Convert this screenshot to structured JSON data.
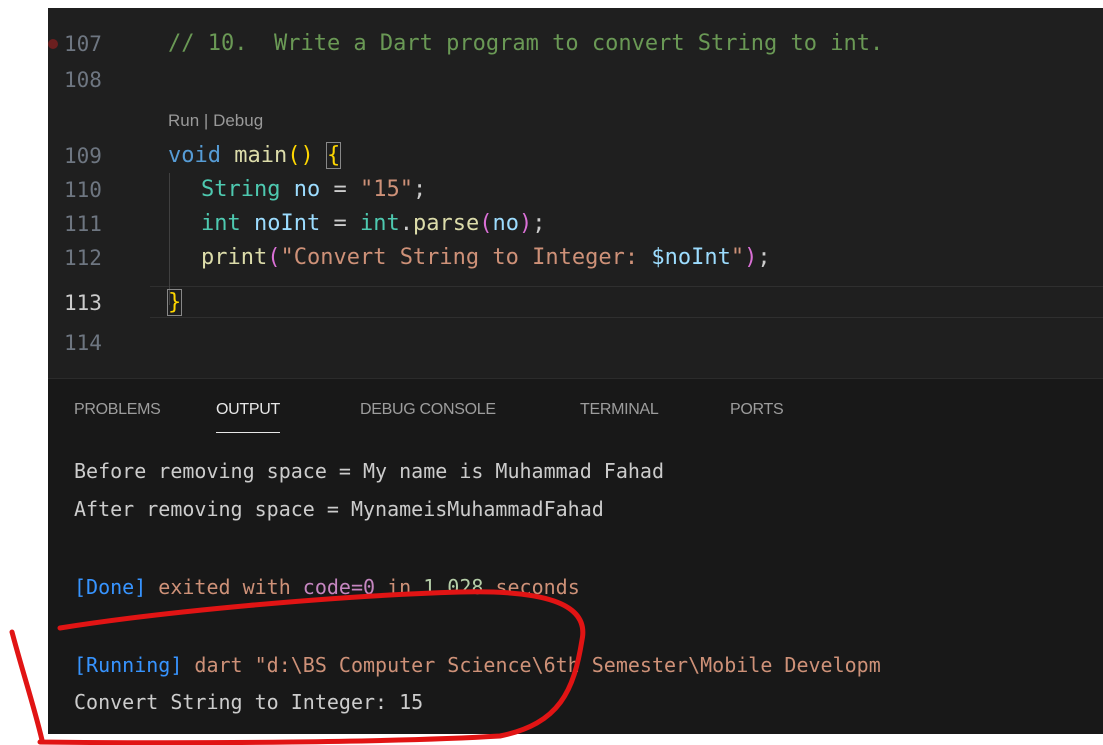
{
  "editor": {
    "line_numbers": [
      "107",
      "108",
      "109",
      "110",
      "111",
      "112",
      "113",
      "114"
    ],
    "comment": "// 10.  Write a Dart program to convert String to int.",
    "codelens": {
      "run": "Run",
      "separator": " | ",
      "debug": "Debug"
    },
    "code": {
      "void": "void",
      "main": "main",
      "parens": "()",
      "open_brace": "{",
      "string_type": "String",
      "no_var": "no",
      "eq": " = ",
      "str_15": "\"15\"",
      "semicolon": ";",
      "int_type": "int",
      "noint_var": "noInt",
      "int_class": "int",
      "dot": ".",
      "parse": "parse",
      "lparen": "(",
      "rparen": ")",
      "print": "print",
      "print_str": "\"Convert String to Integer: ",
      "interp": "$noInt",
      "close_quote": "\"",
      "close_brace": "}"
    }
  },
  "panel": {
    "tabs": [
      "PROBLEMS",
      "OUTPUT",
      "DEBUG CONSOLE",
      "TERMINAL",
      "PORTS"
    ],
    "active_tab": "OUTPUT",
    "output": {
      "line1": "Before removing space = My name is Muhammad Fahad",
      "line2": "After removing space = MynameisMuhammadFahad",
      "done_tag": "[Done]",
      "done_text": " exited with ",
      "code_text": "code=0",
      "in_text": " in ",
      "seconds_value": "1.028",
      "seconds_text": " seconds",
      "running_tag": "[Running]",
      "running_cmd": " dart \"d:\\BS Computer Science\\6th Semester\\Mobile Developm",
      "result": "Convert String to Integer: 15"
    }
  },
  "colors": {
    "annotation": "#e11414"
  }
}
